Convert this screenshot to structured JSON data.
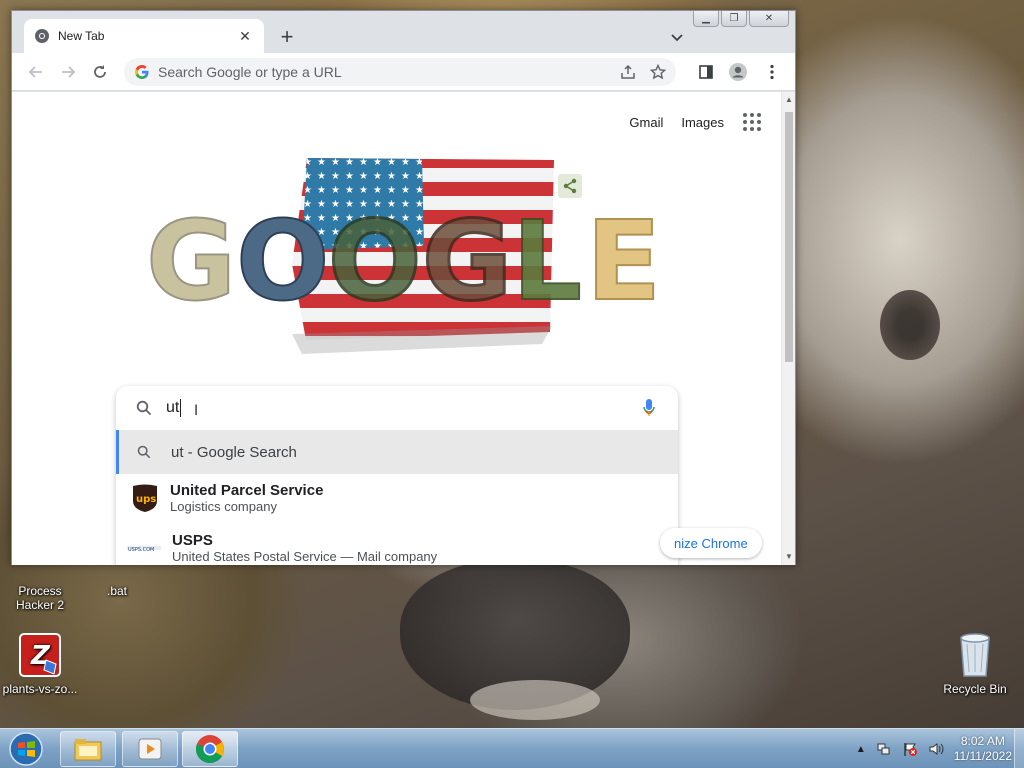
{
  "window": {
    "tab_title": "New Tab",
    "omnibox_placeholder": "Search Google or type a URL"
  },
  "page": {
    "gmail_link": "Gmail",
    "images_link": "Images",
    "doodle_letters": [
      "G",
      "O",
      "O",
      "G",
      "L",
      "E"
    ],
    "search_value": "ut",
    "suggestions": [
      {
        "text": "ut - Google Search"
      },
      {
        "title": "United Parcel Service",
        "subtitle": "Logistics company",
        "logo": "ups-logo-icon"
      },
      {
        "title": "USPS",
        "subtitle": "United States Postal Service — Mail company",
        "logo": "usps-logo-icon"
      }
    ],
    "customize_label": "nize Chrome"
  },
  "desktop": {
    "icons": [
      {
        "label_line1": "Process",
        "label_line2": "Hacker 2"
      },
      {
        "label_line1": ".bat",
        "label_line2": ""
      },
      {
        "label_line1": "plants-vs-zo...",
        "label_line2": ""
      },
      {
        "label_line1": "Recycle Bin",
        "label_line2": ""
      }
    ]
  },
  "taskbar": {
    "time": "8:02 AM",
    "date": "11/11/2022"
  },
  "colors": {
    "accent": "#1a73e8",
    "suggestion_highlight": "#4285f4",
    "ups_brown": "#351c15",
    "ups_gold": "#ffb500"
  }
}
